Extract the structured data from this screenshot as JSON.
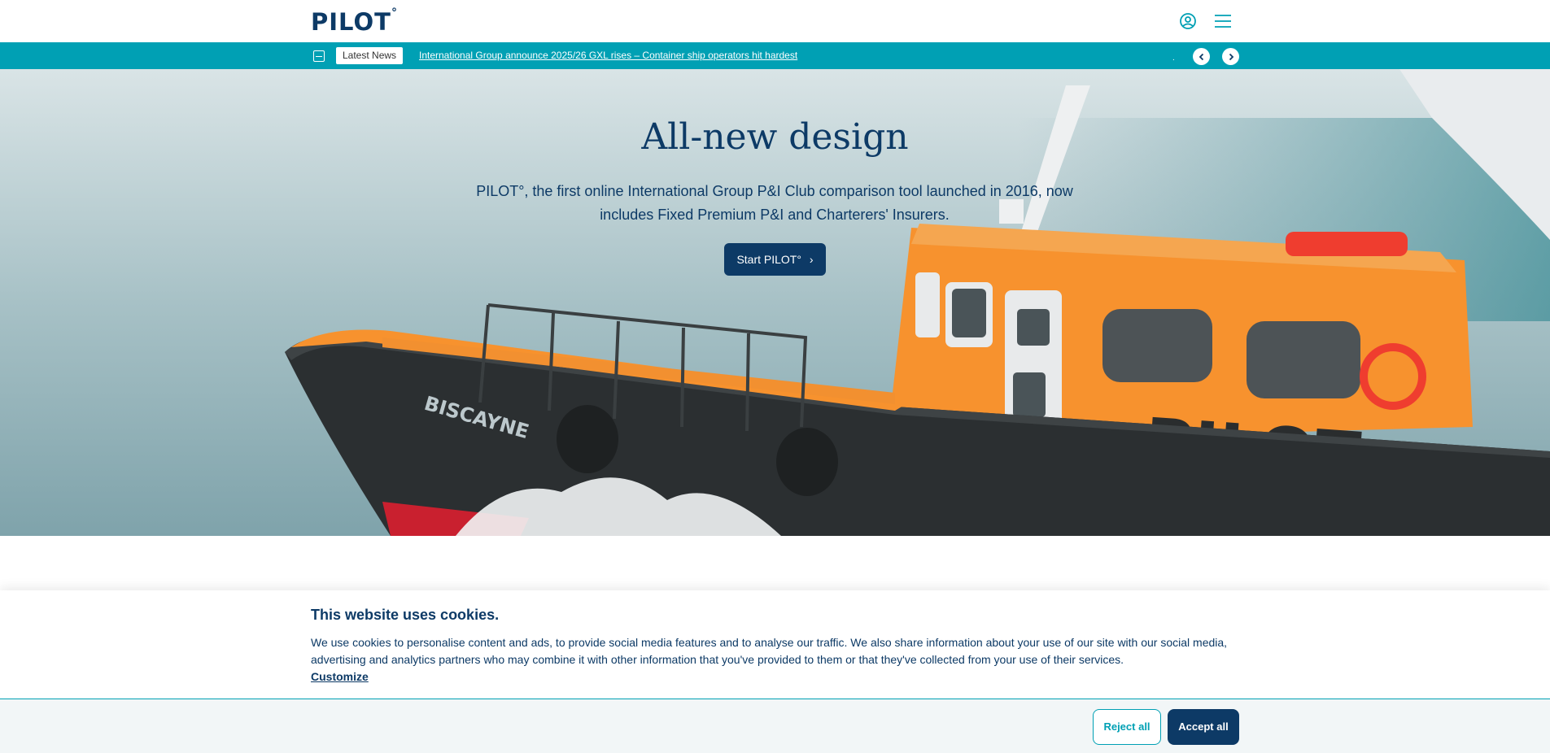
{
  "header": {
    "logo_text": "PILOT",
    "logo_mark": "°",
    "account_icon": "user-circle-icon",
    "menu_icon": "hamburger-icon"
  },
  "ticker": {
    "badge": "Latest News",
    "headline": "International Group announce 2025/26 GXL rises – Container ship operators hit hardest",
    "separator": "."
  },
  "hero": {
    "title": "All-new design",
    "subtitle": "PILOT°, the first online International Group P&I Club comparison tool launched in 2016, now includes Fixed Premium P&I and Charterers' Insurers.",
    "cta_label": "Start PILOT°",
    "boat_name": "BISCAYNE",
    "boat_label": "PILOT"
  },
  "cookie": {
    "title": "This website uses cookies.",
    "text": "We use cookies to personalise content and ads, to provide social media features and to analyse our traffic. We also share information about your use of our site with our social media, advertising and analytics partners who may combine it with other information that you've provided to them or that they've collected from your use of their services.",
    "customize_label": "Customize",
    "reject_label": "Reject all",
    "accept_label": "Accept all"
  },
  "colors": {
    "brand_navy": "#0d3a66",
    "accent_teal": "#00a0b4",
    "boat_orange": "#f7922e"
  }
}
